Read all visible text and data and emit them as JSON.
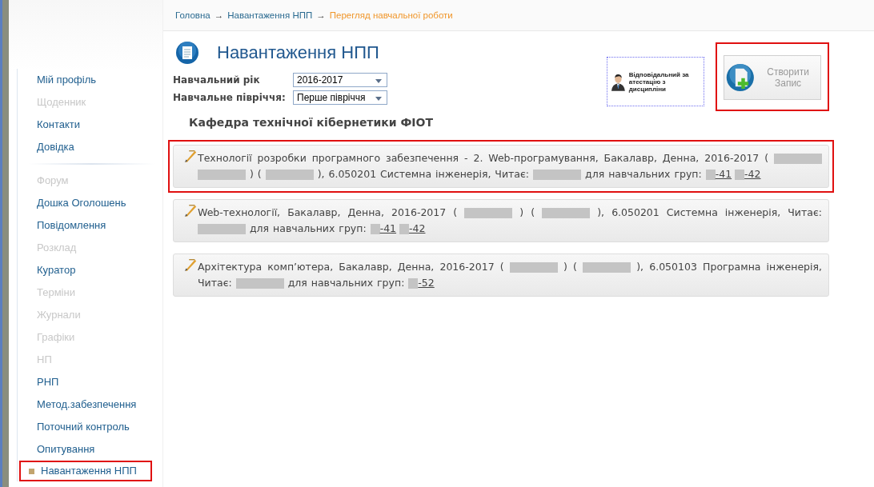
{
  "breadcrumb": [
    {
      "label": "Головна",
      "current": false
    },
    {
      "label": "Навантаження НПП",
      "current": false
    },
    {
      "label": "Перегляд навчальної роботи",
      "current": true
    }
  ],
  "breadcrumb_separator": "→",
  "sidebar": {
    "items": [
      {
        "label": "Мій профіль",
        "disabled": false,
        "selected": false,
        "highlighted": false,
        "divider_after": false
      },
      {
        "label": "Щоденник",
        "disabled": true,
        "selected": false,
        "highlighted": false,
        "divider_after": false
      },
      {
        "label": "Контакти",
        "disabled": false,
        "selected": false,
        "highlighted": false,
        "divider_after": false
      },
      {
        "label": "Довідка",
        "disabled": false,
        "selected": false,
        "highlighted": false,
        "divider_after": true
      },
      {
        "label": "Форум",
        "disabled": true,
        "selected": false,
        "highlighted": false,
        "divider_after": false
      },
      {
        "label": "Дошка Оголошень",
        "disabled": false,
        "selected": false,
        "highlighted": false,
        "divider_after": false
      },
      {
        "label": "Повідомлення",
        "disabled": false,
        "selected": false,
        "highlighted": false,
        "divider_after": false
      },
      {
        "label": "Розклад",
        "disabled": true,
        "selected": false,
        "highlighted": false,
        "divider_after": false
      },
      {
        "label": "Куратор",
        "disabled": false,
        "selected": false,
        "highlighted": false,
        "divider_after": false
      },
      {
        "label": "Терміни",
        "disabled": true,
        "selected": false,
        "highlighted": false,
        "divider_after": false
      },
      {
        "label": "Журнали",
        "disabled": true,
        "selected": false,
        "highlighted": false,
        "divider_after": false
      },
      {
        "label": "Графіки",
        "disabled": true,
        "selected": false,
        "highlighted": false,
        "divider_after": false
      },
      {
        "label": "НП",
        "disabled": true,
        "selected": false,
        "highlighted": false,
        "divider_after": false
      },
      {
        "label": "РНП",
        "disabled": false,
        "selected": false,
        "highlighted": false,
        "divider_after": false
      },
      {
        "label": "Метод.забезпечення",
        "disabled": false,
        "selected": false,
        "highlighted": false,
        "divider_after": false
      },
      {
        "label": "Поточний контроль",
        "disabled": false,
        "selected": false,
        "highlighted": false,
        "divider_after": false
      },
      {
        "label": "Опитування",
        "disabled": false,
        "selected": false,
        "highlighted": false,
        "divider_after": false
      },
      {
        "label": "Навантаження НПП",
        "disabled": false,
        "selected": true,
        "highlighted": true,
        "divider_after": false
      }
    ]
  },
  "page_title": "Навантаження НПП",
  "filters": [
    {
      "label": "Навчальний рік",
      "value": "2016-2017"
    },
    {
      "label": "Навчальне півріччя:",
      "value": "Перше півріччя"
    }
  ],
  "responsible_button": {
    "label": "Відповідальний за атестацію з дисципліни",
    "highlighted": false
  },
  "create_button": {
    "label": "Створити Запис",
    "highlighted": true
  },
  "department": "Кафедра технічної кібернетики ФІОТ",
  "records": [
    {
      "highlighted": true,
      "segments": [
        {
          "kind": "text",
          "text": "Технології розробки програмного забезпечення - 2. Web-програмування, Бакалавр, Денна, 2016-2017 ("
        },
        {
          "kind": "redacted"
        },
        {
          "kind": "redacted"
        },
        {
          "kind": "text",
          "text": ") ("
        },
        {
          "kind": "redacted"
        },
        {
          "kind": "text",
          "text": "), 6.050201 Системна інженерія, Читає:"
        },
        {
          "kind": "redacted"
        },
        {
          "kind": "text",
          "text": "для навчальних груп:"
        },
        {
          "kind": "link",
          "text": "-41"
        },
        {
          "kind": "link",
          "text": "-42"
        }
      ]
    },
    {
      "highlighted": false,
      "segments": [
        {
          "kind": "text",
          "text": "Web-технології, Бакалавр, Денна, 2016-2017 ("
        },
        {
          "kind": "redacted"
        },
        {
          "kind": "text",
          "text": ") ("
        },
        {
          "kind": "redacted"
        },
        {
          "kind": "text",
          "text": "), 6.050201 Системна інженерія, Читає:"
        },
        {
          "kind": "redacted"
        },
        {
          "kind": "text",
          "text": "для навчальних груп:"
        },
        {
          "kind": "link",
          "text": "-41"
        },
        {
          "kind": "link",
          "text": "-42"
        }
      ]
    },
    {
      "highlighted": false,
      "segments": [
        {
          "kind": "text",
          "text": "Архітектура комп’ютера, Бакалавр, Денна, 2016-2017 ("
        },
        {
          "kind": "redacted"
        },
        {
          "kind": "text",
          "text": ") ("
        },
        {
          "kind": "redacted"
        },
        {
          "kind": "text",
          "text": "), 6.050103 Програмна інженерія, Читає:"
        },
        {
          "kind": "redacted"
        },
        {
          "kind": "text",
          "text": "для навчальних груп:"
        },
        {
          "kind": "link",
          "text": "-52"
        }
      ]
    }
  ]
}
